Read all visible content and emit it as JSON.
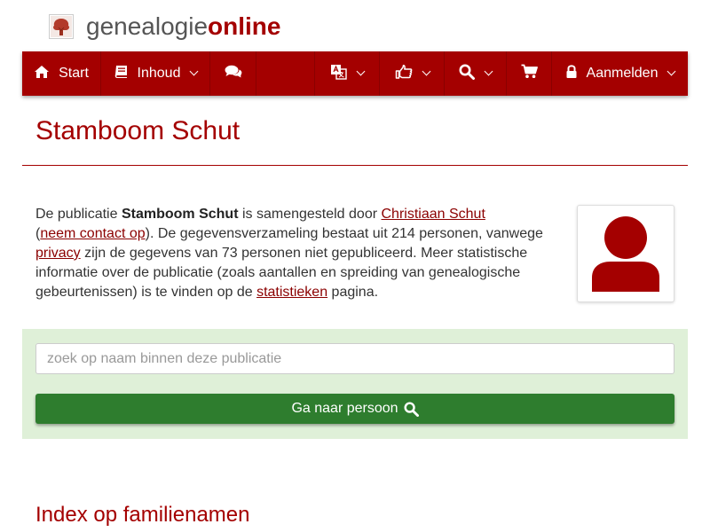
{
  "logo": {
    "text_plain": "genealogie",
    "text_bold": "online"
  },
  "nav": {
    "start": "Start",
    "inhoud": "Inhoud",
    "aanmelden": "Aanmelden"
  },
  "page": {
    "title": "Stamboom Schut",
    "intro": {
      "p1": "De publicatie ",
      "pub_name": "Stamboom Schut",
      "p2": " is samengesteld door ",
      "author_link": "Christiaan Schut",
      "p3": "(",
      "contact_link": "neem contact op",
      "p4": "). De gegevensverzameling bestaat uit 214 personen, vanwege ",
      "privacy_link": "privacy",
      "p5": " zijn de gegevens van 73 personen niet gepubliceerd. Meer statistische informatie over de publicatie (zoals aantallen en spreiding van genealogische gebeurtenissen) is te vinden op de ",
      "stats_link": "statistieken",
      "p6": " pagina."
    }
  },
  "search": {
    "placeholder": "zoek op naam binnen deze publicatie",
    "button_label": "Ga naar persoon"
  },
  "index": {
    "title": "Index op familienamen"
  },
  "colors": {
    "brand": "#a40000",
    "panel": "#dff0d8",
    "button": "#2e7d2e"
  },
  "icons": [
    "tree-logo-icon",
    "home-icon",
    "book-icon",
    "comments-icon",
    "language-icon",
    "thumbs-up-icon",
    "search-icon",
    "cart-icon",
    "lock-icon",
    "user-avatar-icon"
  ]
}
